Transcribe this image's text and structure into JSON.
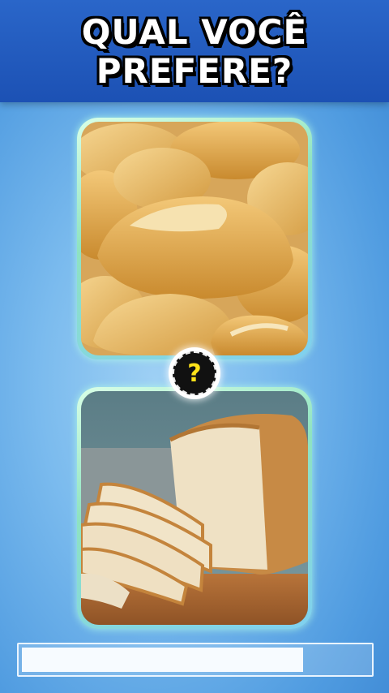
{
  "header": {
    "title_line1": "QUAL VOCÊ",
    "title_line2": "PREFERE?"
  },
  "options": [
    {
      "id": "option-a",
      "subject": "french-bread-rolls"
    },
    {
      "id": "option-b",
      "subject": "sliced-white-bread-loaf"
    }
  ],
  "versus_badge": {
    "symbol": "?"
  },
  "progress": {
    "fraction": 0.81
  },
  "colors": {
    "header": "#1c51b4",
    "background": "#7bbbee",
    "card_border": "#8fe3c0",
    "question_mark": "#ffe21a"
  }
}
